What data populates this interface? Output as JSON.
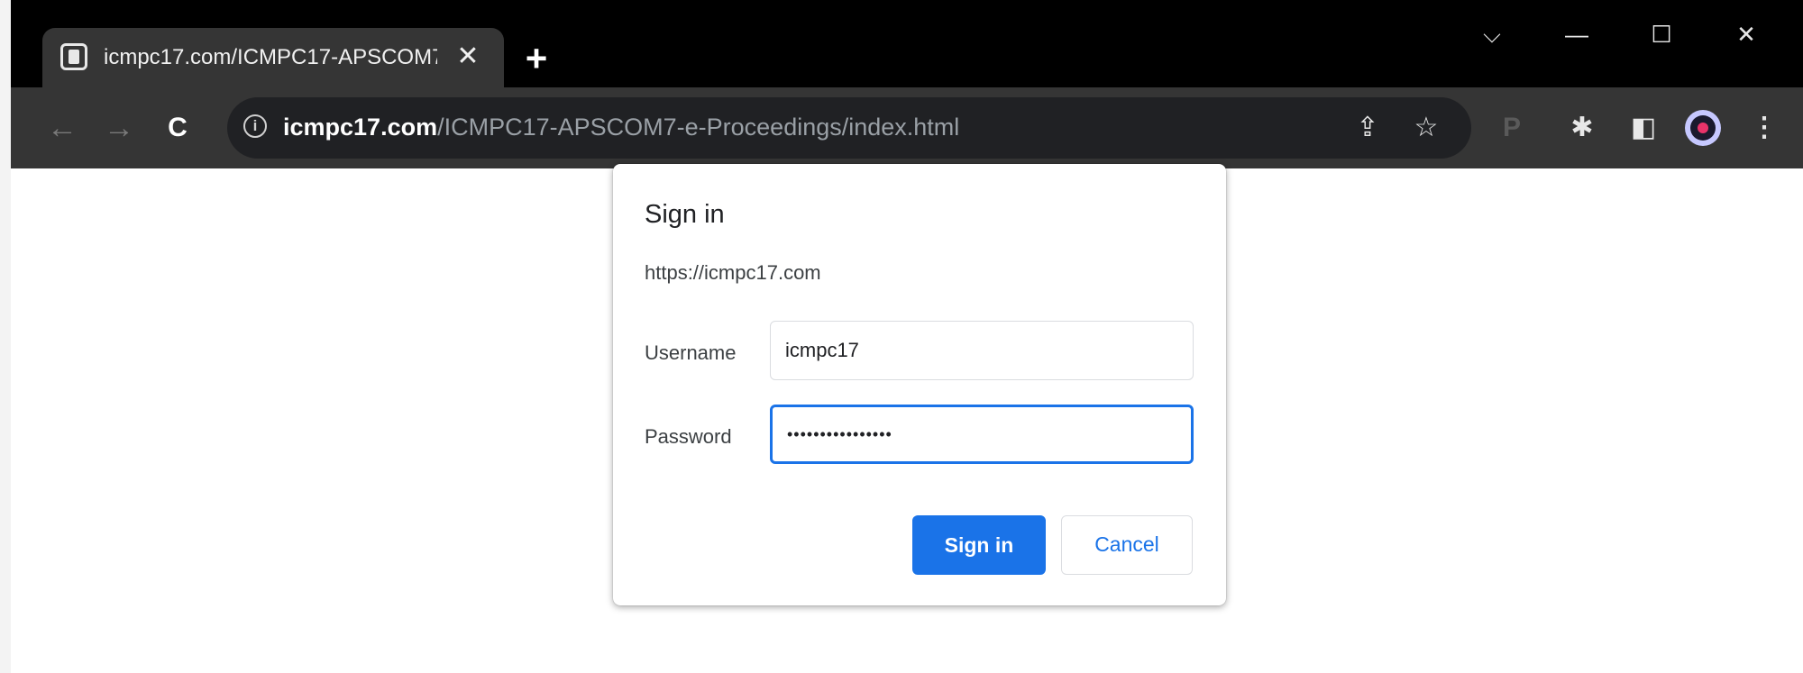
{
  "browser": {
    "tab": {
      "title": "icmpc17.com/ICMPC17-APSCOM7",
      "close_glyph": "✕",
      "favicon": "document-icon"
    },
    "new_tab_glyph": "+",
    "window_controls": {
      "tab_search_glyph": "⌵",
      "minimize_glyph": "—",
      "maximize_glyph": "☐",
      "close_glyph": "✕"
    },
    "nav": {
      "back_glyph": "←",
      "forward_glyph": "→",
      "reload_glyph": "C"
    },
    "address": {
      "host": "icmpc17.com",
      "path": "/ICMPC17-APSCOM7-e-Proceedings/index.html",
      "info_glyph": "i"
    },
    "toolbar_icons": {
      "share_glyph": "⇪",
      "star_glyph": "☆",
      "p_glyph": "P",
      "extensions_glyph": "✱",
      "sidepanel_glyph": "◧",
      "menu_glyph": "⋮"
    }
  },
  "dialog": {
    "title": "Sign in",
    "origin": "https://icmpc17.com",
    "username_label": "Username",
    "username_value": "icmpc17",
    "password_label": "Password",
    "password_value": "••••••••••••••••",
    "sign_in_label": "Sign in",
    "cancel_label": "Cancel"
  },
  "colors": {
    "accent": "#1a73e8",
    "titlebar": "#000000",
    "toolbar": "#353535"
  }
}
